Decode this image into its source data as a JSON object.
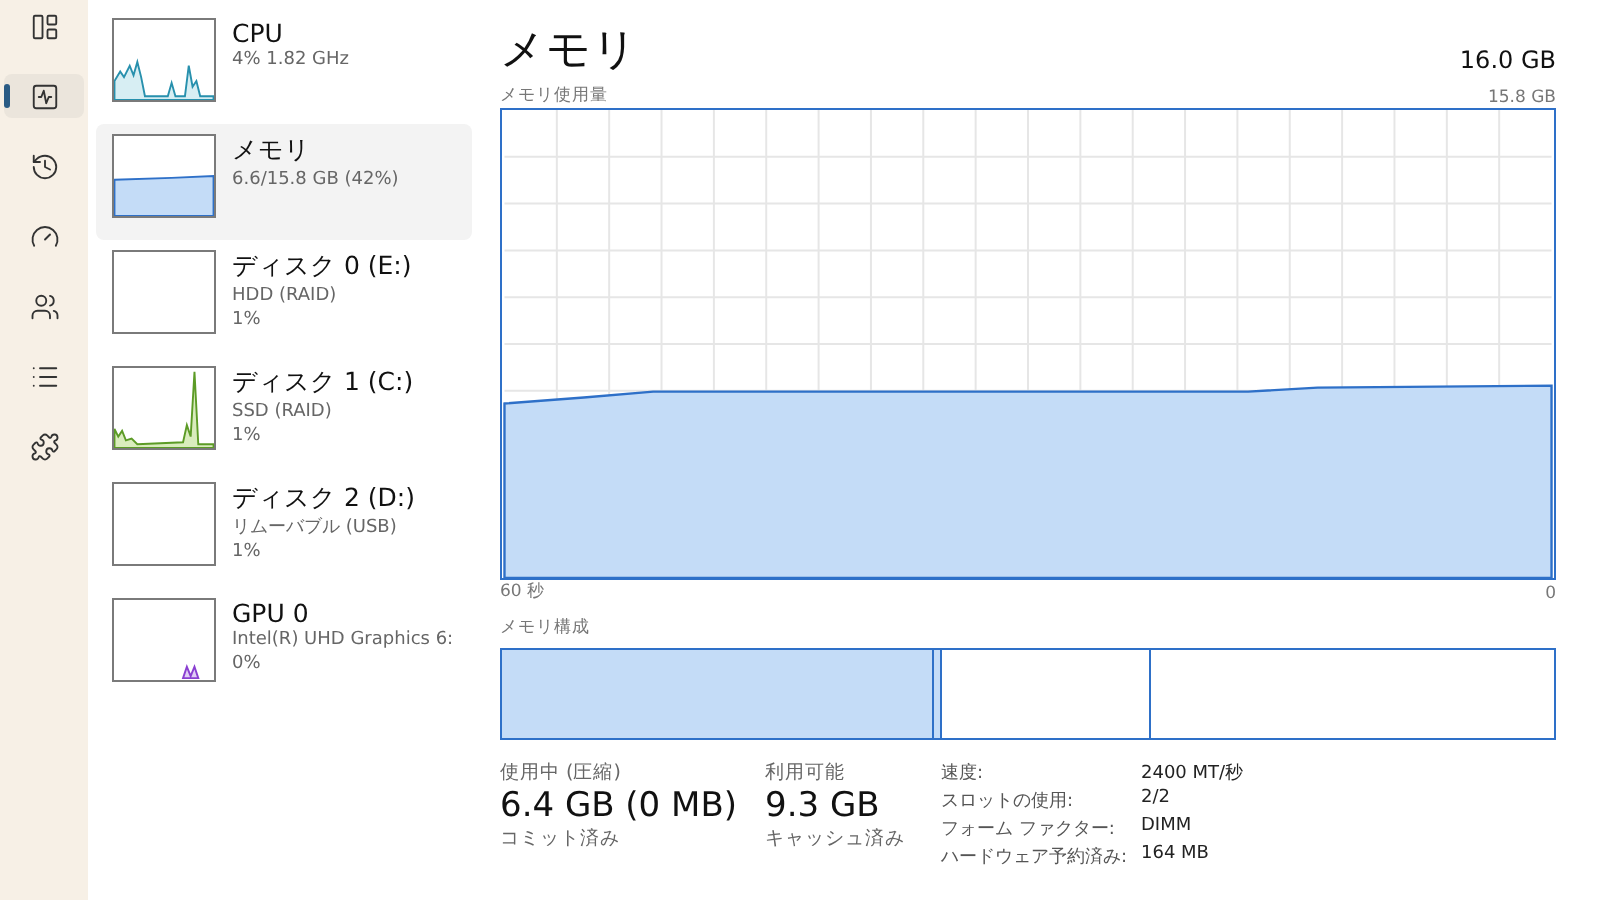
{
  "nav": [
    {
      "kind": "processes",
      "selected": false
    },
    {
      "kind": "performance",
      "selected": true
    },
    {
      "kind": "history",
      "selected": false
    },
    {
      "kind": "startup",
      "selected": false
    },
    {
      "kind": "users",
      "selected": false
    },
    {
      "kind": "details",
      "selected": false
    },
    {
      "kind": "services",
      "selected": false
    }
  ],
  "devices": [
    {
      "kind": "cpu",
      "name": "CPU",
      "lines": [
        "4%  1.82 GHz"
      ],
      "selected": false
    },
    {
      "kind": "memory",
      "name": "メモリ",
      "lines": [
        "6.6/15.8 GB (42%)"
      ],
      "selected": true
    },
    {
      "kind": "empty",
      "name": "ディスク 0 (E:)",
      "lines": [
        "HDD (RAID)",
        "1%"
      ],
      "selected": false
    },
    {
      "kind": "disk",
      "name": "ディスク 1 (C:)",
      "lines": [
        "SSD (RAID)",
        "1%"
      ],
      "selected": false
    },
    {
      "kind": "empty",
      "name": "ディスク 2 (D:)",
      "lines": [
        "リムーバブル (USB)",
        "1%"
      ],
      "selected": false
    },
    {
      "kind": "gpu",
      "name": "GPU 0",
      "lines": [
        "Intel(R) UHD Graphics 6:",
        "0%"
      ],
      "selected": false
    }
  ],
  "main": {
    "title": "メモリ",
    "total": "16.0 GB",
    "chart_label": "メモリ使用量",
    "chart_max": "15.8 GB",
    "time_start": "60 秒",
    "time_end": "0",
    "composition_label": "メモリ構成",
    "stats": [
      {
        "label": "使用中 (圧縮)",
        "value": "6.4 GB (0 MB)"
      },
      {
        "label": "利用可能",
        "value": "9.3 GB"
      }
    ],
    "stats_next": [
      "コミット済み",
      "キャッシュ済み"
    ],
    "details": [
      {
        "key": "速度:",
        "value": "2400 MT/秒"
      },
      {
        "key": "スロットの使用:",
        "value": "2/2"
      },
      {
        "key": "フォーム ファクター:",
        "value": "DIMM"
      },
      {
        "key": "ハードウェア予約済み:",
        "value": "164 MB"
      }
    ]
  }
}
